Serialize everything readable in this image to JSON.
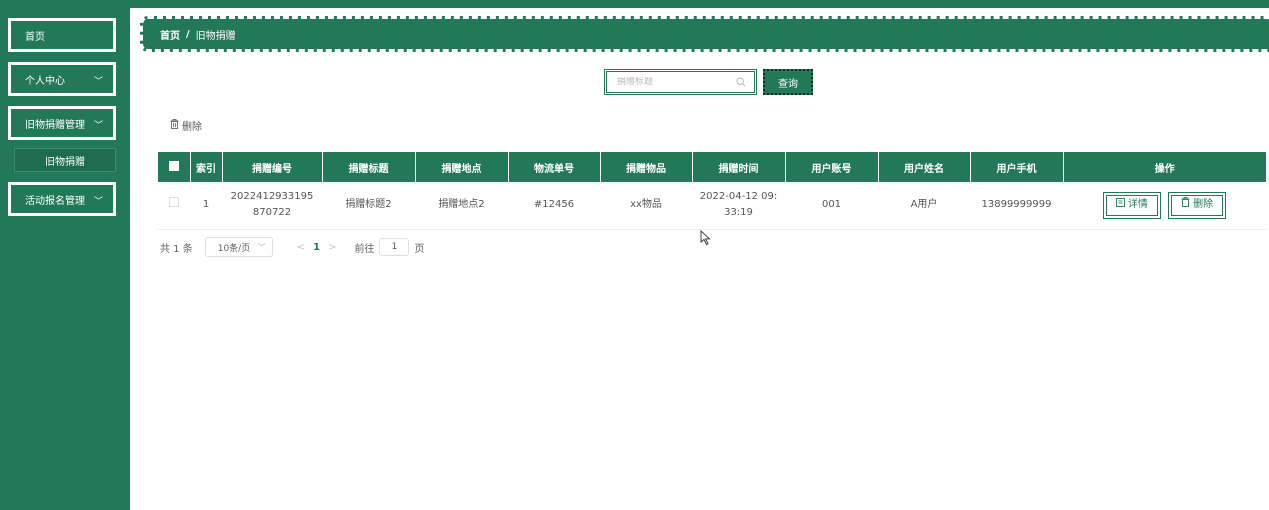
{
  "sidebar": {
    "items": [
      {
        "label": "首页"
      },
      {
        "label": "个人中心"
      },
      {
        "label": "旧物捐赠管理"
      },
      {
        "label": "活动报名管理"
      }
    ],
    "subitem": {
      "label": "旧物捐赠"
    }
  },
  "breadcrumb": {
    "home": "首页",
    "separator": "/",
    "current": "旧物捐赠"
  },
  "search": {
    "placeholder": "捐赠标题",
    "value": ""
  },
  "toolbar": {
    "query_label": "查询",
    "batch_delete_label": "删除"
  },
  "table": {
    "headers": [
      "索引",
      "捐赠编号",
      "捐赠标题",
      "捐赠地点",
      "物流单号",
      "捐赠物品",
      "捐赠时间",
      "用户账号",
      "用户姓名",
      "用户手机",
      "操作"
    ],
    "rows": [
      {
        "index": "1",
        "code": "2022412933195870722",
        "title": "捐赠标题2",
        "location": "捐赠地点2",
        "tracking": "#12456",
        "item": "xx物品",
        "time": "2022-04-12 09:33:19",
        "account": "001",
        "name": "A用户",
        "phone": "13899999999",
        "detail_label": "详情",
        "delete_label": "删除"
      }
    ]
  },
  "pager": {
    "total_text": "共 1 条",
    "page_size": "10条/页",
    "current_page": "1",
    "goto_prefix": "前往",
    "goto_value": "1",
    "goto_suffix": "页"
  },
  "colors": {
    "accent": "#24785a",
    "white": "#ffffff"
  }
}
